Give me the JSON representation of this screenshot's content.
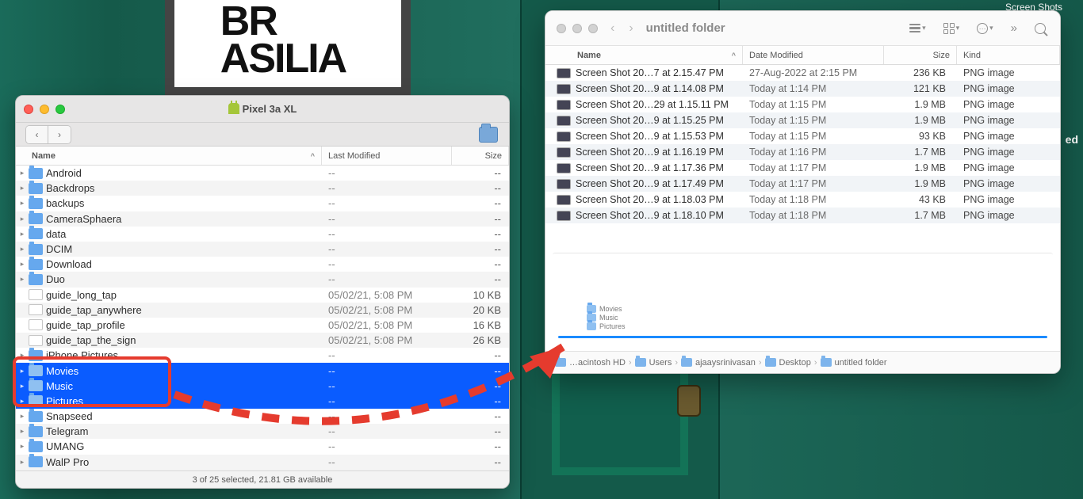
{
  "desktop_label": "Screen Shots",
  "cutoff_label": "ed",
  "poster_text": "BR\nASILIA",
  "windowA": {
    "title": "Pixel 3a XL",
    "columns": {
      "name": "Name",
      "modified": "Last Modified",
      "size": "Size"
    },
    "rows": [
      {
        "name": "Android",
        "type": "folder",
        "expandable": true,
        "modified": "--",
        "size": "--"
      },
      {
        "name": "Backdrops",
        "type": "folder",
        "expandable": true,
        "modified": "--",
        "size": "--"
      },
      {
        "name": "backups",
        "type": "folder",
        "expandable": true,
        "modified": "--",
        "size": "--"
      },
      {
        "name": "CameraSphaera",
        "type": "folder",
        "expandable": true,
        "modified": "--",
        "size": "--"
      },
      {
        "name": "data",
        "type": "folder",
        "expandable": true,
        "modified": "--",
        "size": "--"
      },
      {
        "name": "DCIM",
        "type": "folder",
        "expandable": true,
        "modified": "--",
        "size": "--"
      },
      {
        "name": "Download",
        "type": "folder",
        "expandable": true,
        "modified": "--",
        "size": "--"
      },
      {
        "name": "Duo",
        "type": "folder",
        "expandable": true,
        "modified": "--",
        "size": "--"
      },
      {
        "name": "guide_long_tap",
        "type": "file",
        "expandable": false,
        "modified": "05/02/21, 5:08 PM",
        "size": "10 KB"
      },
      {
        "name": "guide_tap_anywhere",
        "type": "file",
        "expandable": false,
        "modified": "05/02/21, 5:08 PM",
        "size": "20 KB"
      },
      {
        "name": "guide_tap_profile",
        "type": "file",
        "expandable": false,
        "modified": "05/02/21, 5:08 PM",
        "size": "16 KB"
      },
      {
        "name": "guide_tap_the_sign",
        "type": "file",
        "expandable": false,
        "modified": "05/02/21, 5:08 PM",
        "size": "26 KB"
      },
      {
        "name": "iPhone Pictures",
        "type": "folder",
        "expandable": true,
        "modified": "--",
        "size": "--"
      },
      {
        "name": "Movies",
        "type": "folder",
        "expandable": true,
        "modified": "--",
        "size": "--",
        "selected": true
      },
      {
        "name": "Music",
        "type": "folder",
        "expandable": true,
        "modified": "--",
        "size": "--",
        "selected": true
      },
      {
        "name": "Pictures",
        "type": "folder",
        "expandable": true,
        "modified": "--",
        "size": "--",
        "selected": true
      },
      {
        "name": "Snapseed",
        "type": "folder",
        "expandable": true,
        "modified": "--",
        "size": "--"
      },
      {
        "name": "Telegram",
        "type": "folder",
        "expandable": true,
        "modified": "--",
        "size": "--"
      },
      {
        "name": "UMANG",
        "type": "folder",
        "expandable": true,
        "modified": "--",
        "size": "--"
      },
      {
        "name": "WalP Pro",
        "type": "folder",
        "expandable": true,
        "modified": "--",
        "size": "--"
      }
    ],
    "status": "3 of 25 selected, 21.81 GB available"
  },
  "windowB": {
    "title": "untitled folder",
    "columns": {
      "name": "Name",
      "modified": "Date Modified",
      "size": "Size",
      "kind": "Kind"
    },
    "rows": [
      {
        "name": "Screen Shot 20…7 at 2.15.47 PM",
        "modified": "27-Aug-2022 at 2:15 PM",
        "size": "236 KB",
        "kind": "PNG image"
      },
      {
        "name": "Screen Shot 20…9 at 1.14.08 PM",
        "modified": "Today at 1:14 PM",
        "size": "121 KB",
        "kind": "PNG image"
      },
      {
        "name": "Screen Shot 20…29 at 1.15.11 PM",
        "modified": "Today at 1:15 PM",
        "size": "1.9 MB",
        "kind": "PNG image"
      },
      {
        "name": "Screen Shot 20…9 at 1.15.25 PM",
        "modified": "Today at 1:15 PM",
        "size": "1.9 MB",
        "kind": "PNG image"
      },
      {
        "name": "Screen Shot 20…9 at 1.15.53 PM",
        "modified": "Today at 1:15 PM",
        "size": "93 KB",
        "kind": "PNG image"
      },
      {
        "name": "Screen Shot 20…9 at 1.16.19 PM",
        "modified": "Today at 1:16 PM",
        "size": "1.7 MB",
        "kind": "PNG image"
      },
      {
        "name": "Screen Shot 20…9 at 1.17.36 PM",
        "modified": "Today at 1:17 PM",
        "size": "1.9 MB",
        "kind": "PNG image"
      },
      {
        "name": "Screen Shot 20…9 at 1.17.49 PM",
        "modified": "Today at 1:17 PM",
        "size": "1.9 MB",
        "kind": "PNG image"
      },
      {
        "name": "Screen Shot 20…9 at 1.18.03 PM",
        "modified": "Today at 1:18 PM",
        "size": "43 KB",
        "kind": "PNG image"
      },
      {
        "name": "Screen Shot 20…9 at 1.18.10 PM",
        "modified": "Today at 1:18 PM",
        "size": "1.7 MB",
        "kind": "PNG image"
      }
    ],
    "ghost_items": [
      "Movies",
      "Music",
      "Pictures"
    ],
    "pathbar": [
      "…acintosh HD",
      "Users",
      "ajaaysrinivasan",
      "Desktop",
      "untitled folder"
    ]
  }
}
